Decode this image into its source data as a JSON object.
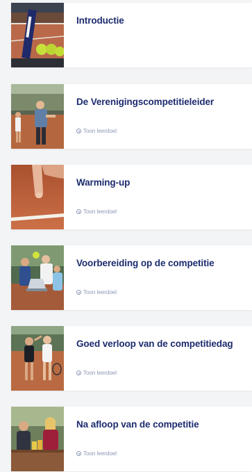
{
  "modules": [
    {
      "title": "Introductie",
      "goal_label": "",
      "image": "tennis-racket-balls-photo"
    },
    {
      "title": "De Verenigingscompetitieleider",
      "goal_label": "Toon leerdoel",
      "image": "competition-leader-photo"
    },
    {
      "title": "Warming-up",
      "goal_label": "Toon leerdoel",
      "image": "finger-clay-court-photo"
    },
    {
      "title": "Voorbereiding op de competitie",
      "goal_label": "Toon leerdoel",
      "image": "team-laptop-photo"
    },
    {
      "title": "Goed verloop van de competitiedag",
      "goal_label": "Toon leerdoel",
      "image": "players-high-five-photo"
    },
    {
      "title": "Na afloop van de competitie",
      "goal_label": "Toon leerdoel",
      "image": "after-match-drinks-photo"
    }
  ],
  "colors": {
    "title": "#1c2b6e",
    "goal": "#8c97b6",
    "card": "#ffffff",
    "background": "#f3f4f6",
    "clay": "#c4653e"
  }
}
